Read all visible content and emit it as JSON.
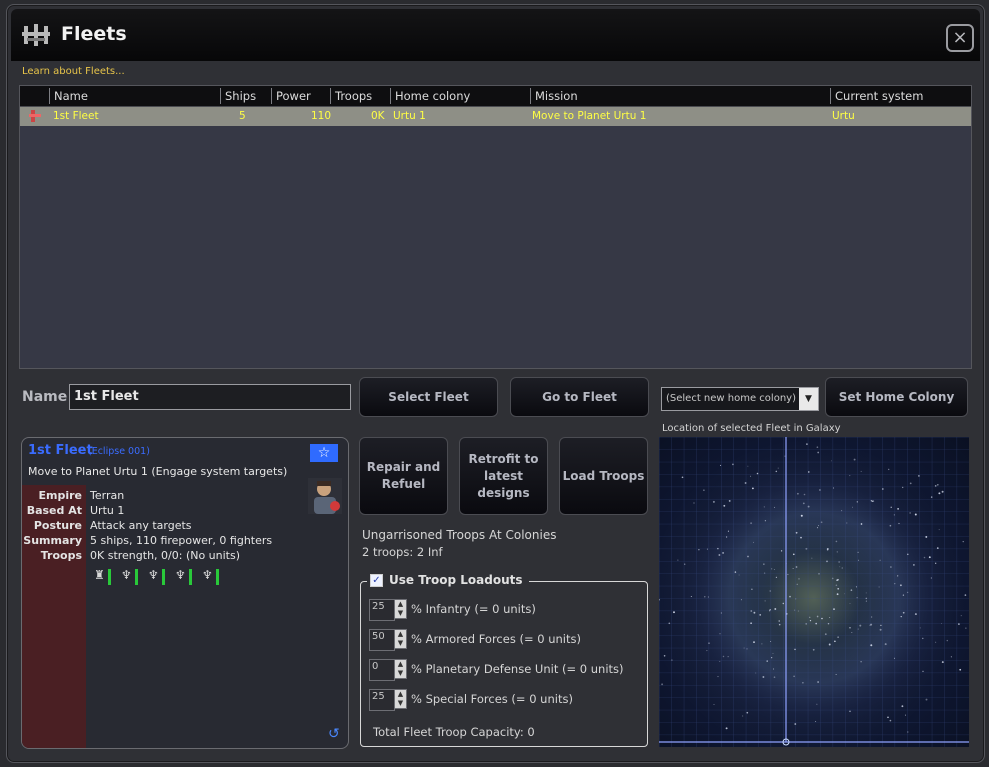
{
  "window": {
    "title": "Fleets",
    "learn_link": "Learn about Fleets..."
  },
  "table": {
    "columns": [
      "Name",
      "Ships",
      "Power",
      "Troops",
      "Home colony",
      "Mission",
      "Current system"
    ],
    "rows": [
      {
        "name": "1st Fleet",
        "ships": "5",
        "power": "110",
        "troops": "0K",
        "home_colony": "Urtu 1",
        "mission": "Move to Planet Urtu 1",
        "current_system": "Urtu"
      }
    ]
  },
  "controls": {
    "name_label": "Name",
    "name_value": "1st Fleet",
    "select_fleet": "Select Fleet",
    "go_to_fleet": "Go to Fleet",
    "home_colony_select": "(Select new home colony)",
    "set_home_colony": "Set Home Colony",
    "repair_refuel": "Repair and Refuel",
    "retrofit": "Retrofit to latest designs",
    "load_troops": "Load Troops"
  },
  "fleet_card": {
    "title": "1st Fleet",
    "design_class": "(Eclipse 001)",
    "mission": "Move to Planet Urtu 1 (Engage system targets)",
    "fields": [
      {
        "key": "Empire",
        "value": "Terran"
      },
      {
        "key": "Based At",
        "value": "Urtu 1"
      },
      {
        "key": "Posture",
        "value": "Attack any targets"
      },
      {
        "key": "Summary",
        "value": "5 ships, 110 firepower, 0 fighters"
      },
      {
        "key": "Troops",
        "value": "0K strength, 0/0: (No units)"
      }
    ],
    "icons": [
      "star-icon",
      "commander-portrait",
      "refresh-icon"
    ]
  },
  "ungarrisoned": {
    "title": "Ungarrisoned Troops At Colonies",
    "detail": "2 troops: 2 Inf"
  },
  "loadouts": {
    "legend": "Use Troop Loadouts",
    "checked": true,
    "rows": [
      {
        "value": "25",
        "label": "% Infantry (= 0 units)"
      },
      {
        "value": "50",
        "label": "% Armored Forces (= 0 units)"
      },
      {
        "value": "0",
        "label": "% Planetary Defense Unit (= 0 units)"
      },
      {
        "value": "25",
        "label": "% Special Forces (= 0 units)"
      }
    ],
    "total": "Total Fleet Troop Capacity: 0"
  },
  "galaxy": {
    "caption": "Location of selected Fleet in Galaxy"
  },
  "colors": {
    "row_text": "#ffff44",
    "selected_row_bg": "#8e8f86",
    "card_title": "#3a6cff",
    "link": "#e8c54a"
  }
}
